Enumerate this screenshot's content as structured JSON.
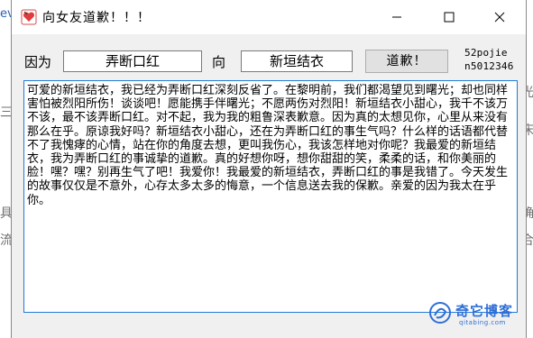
{
  "background": {
    "left_glyphs": [
      "ev",
      "三",
      "具",
      "流"
    ],
    "right_glyphs": [
      "光",
      "床",
      "确",
      "合"
    ]
  },
  "window": {
    "title": "向女友道歉！！！",
    "icon": "heart-app-icon",
    "minimize_symbol": "—",
    "maximize_symbol": "☐",
    "close_symbol": "✕"
  },
  "form": {
    "because_label": "因为",
    "reason_value": "弄断口红",
    "to_label": "向",
    "recipient_value": "新垣结衣",
    "apologize_button": "道歉！",
    "brand_line1": "52pojie",
    "brand_line2": "n5012346"
  },
  "output": {
    "text": "可爱的新垣结衣，我已经为弄断口红深刻反省了。在黎明前，我们都渴望见到曙光；却也同样害怕被烈阳所伤！谈谈吧！愿能携手伴曙光；不愿两伤对烈阳！新垣结衣小甜心，我千不该万不该，最不该弄断口红。对不起，我为我的粗鲁深表歉意。因为真的太想见你，心里从来没有那么在乎。原谅我好吗？新垣结衣小甜心，还在为弄断口红的事生气吗？什么样的话语都代替不了我愧痚的心情，站在你的角度去想，更叫我伤心，我该怎样地对你呢？我最爱的新垣结衣，我为弄断口红的事诚挚的道歉。真的好想你呀，想你甜甜的笑，柔柔的话，和你美丽的脸！嘿？嘿？别再生气了吧！我爱你！我最爱的新垣结衣，弄断口红的事是我错了。今天发生的故事仅仅是不意外，心存太多太多的悔意，一个信息送去我的保歉。亲爱的因为我太在乎你。"
  },
  "watermark": {
    "title": "奇它博客",
    "url": "qitabing.com"
  },
  "colors": {
    "accent": "#1f7bd6",
    "watermark": "#2f6fd6"
  }
}
